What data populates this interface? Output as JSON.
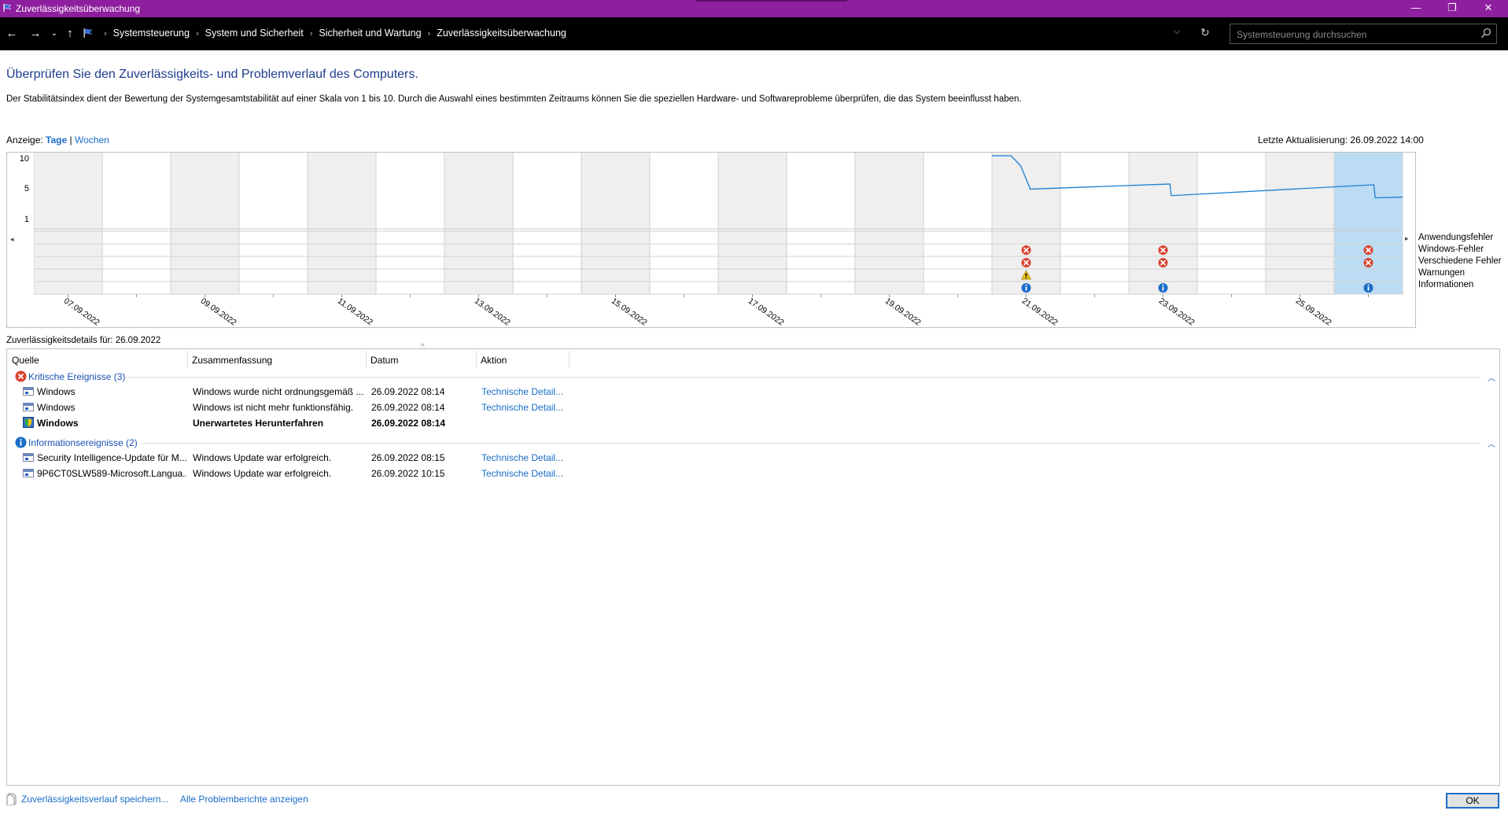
{
  "window": {
    "title": "Zuverlässigkeitsüberwachung",
    "minimize": "—",
    "maximize": "❐",
    "close": "✕"
  },
  "address": {
    "crumbs": [
      "Systemsteuerung",
      "System und Sicherheit",
      "Sicherheit und Wartung",
      "Zuverlässigkeitsüberwachung"
    ],
    "search_placeholder": "Systemsteuerung durchsuchen"
  },
  "page": {
    "heading": "Überprüfen Sie den Zuverlässigkeits- und Problemverlauf des Computers.",
    "description": "Der Stabilitätsindex dient der Bewertung der Systemgesamtstabilität auf einer Skala von 1 bis 10. Durch die Auswahl eines bestimmten Zeitraums können Sie die speziellen Hardware- und Softwareprobleme überprüfen, die das System beeinflusst haben.",
    "view_label": "Anzeige:",
    "view_days": "Tage",
    "view_sep": "|",
    "view_weeks": "Wochen",
    "last_update": "Letzte Aktualisierung: 26.09.2022 14:00"
  },
  "chart_data": {
    "type": "line",
    "y_ticks": [
      "10",
      "5",
      "1"
    ],
    "ylim": [
      1,
      10
    ],
    "date_labels": [
      "07.09.2022",
      "09.09.2022",
      "11.09.2022",
      "13.09.2022",
      "15.09.2022",
      "17.09.2022",
      "19.09.2022",
      "21.09.2022",
      "23.09.2022",
      "25.09.2022"
    ],
    "days": [
      "07.09.2022",
      "08.09.2022",
      "09.09.2022",
      "10.09.2022",
      "11.09.2022",
      "12.09.2022",
      "13.09.2022",
      "14.09.2022",
      "15.09.2022",
      "16.09.2022",
      "17.09.2022",
      "18.09.2022",
      "19.09.2022",
      "20.09.2022",
      "21.09.2022",
      "22.09.2022",
      "23.09.2022",
      "24.09.2022",
      "25.09.2022",
      "26.09.2022"
    ],
    "selected_day": "26.09.2022",
    "stability_index": [
      {
        "day": 14,
        "pos": 0.0,
        "y": 10
      },
      {
        "day": 14,
        "pos": 0.28,
        "y": 10
      },
      {
        "day": 14,
        "pos": 0.42,
        "y": 8.6
      },
      {
        "day": 14,
        "pos": 0.56,
        "y": 5.4
      },
      {
        "day": 16,
        "pos": 0.6,
        "y": 6.1
      },
      {
        "day": 16,
        "pos": 0.62,
        "y": 4.5
      },
      {
        "day": 19,
        "pos": 0.58,
        "y": 6.0
      },
      {
        "day": 19,
        "pos": 0.6,
        "y": 4.2
      },
      {
        "day": 19,
        "pos": 1.0,
        "y": 4.3
      }
    ],
    "event_rows": [
      "Anwendungsfehler",
      "Windows-Fehler",
      "Verschiedene Fehler",
      "Warnungen",
      "Informationen"
    ],
    "events": [
      {
        "day": 14,
        "row": 1,
        "kind": "error"
      },
      {
        "day": 14,
        "row": 2,
        "kind": "error"
      },
      {
        "day": 14,
        "row": 3,
        "kind": "warning"
      },
      {
        "day": 14,
        "row": 4,
        "kind": "info"
      },
      {
        "day": 16,
        "row": 1,
        "kind": "error"
      },
      {
        "day": 16,
        "row": 2,
        "kind": "error"
      },
      {
        "day": 16,
        "row": 4,
        "kind": "info"
      },
      {
        "day": 19,
        "row": 1,
        "kind": "error"
      },
      {
        "day": 19,
        "row": 2,
        "kind": "error"
      },
      {
        "day": 19,
        "row": 4,
        "kind": "info"
      }
    ]
  },
  "details": {
    "title": "Zuverlässigkeitsdetails für: 26.09.2022",
    "columns": [
      "Quelle",
      "Zusammenfassung",
      "Datum",
      "Aktion"
    ],
    "groups": [
      {
        "label": "Kritische Ereignisse (3)",
        "rows": [
          {
            "source": "Windows",
            "summary": "Windows wurde nicht ordnungsgemäß ...",
            "date": "26.09.2022 08:14",
            "action": "Technische Detail...",
            "bold": false,
            "icon": "window"
          },
          {
            "source": "Windows",
            "summary": "Windows ist nicht mehr funktionsfähig.",
            "date": "26.09.2022 08:14",
            "action": "Technische Detail...",
            "bold": false,
            "icon": "window"
          },
          {
            "source": "Windows",
            "summary": "Unerwartetes Herunterfahren",
            "date": "26.09.2022 08:14",
            "action": "",
            "bold": true,
            "icon": "shield"
          }
        ]
      },
      {
        "label": "Informationsereignisse (2)",
        "rows": [
          {
            "source": "Security Intelligence-Update für M...",
            "summary": "Windows Update war erfolgreich.",
            "date": "26.09.2022 08:15",
            "action": "Technische Detail...",
            "bold": false,
            "icon": "window"
          },
          {
            "source": "9P6CT0SLW589-Microsoft.Langua...",
            "summary": "Windows Update war erfolgreich.",
            "date": "26.09.2022 10:15",
            "action": "Technische Detail...",
            "bold": false,
            "icon": "window"
          }
        ]
      }
    ]
  },
  "footer": {
    "save_history": "Zuverlässigkeitsverlauf speichern...",
    "all_reports": "Alle Problemberichte anzeigen",
    "ok": "OK"
  },
  "colors": {
    "titlebar": "#8e1f9e",
    "line": "#1b7fd4",
    "selected": "#bcdcf4",
    "error": "#d9432f",
    "info": "#1a6dc8",
    "warning": "#f0c419"
  }
}
